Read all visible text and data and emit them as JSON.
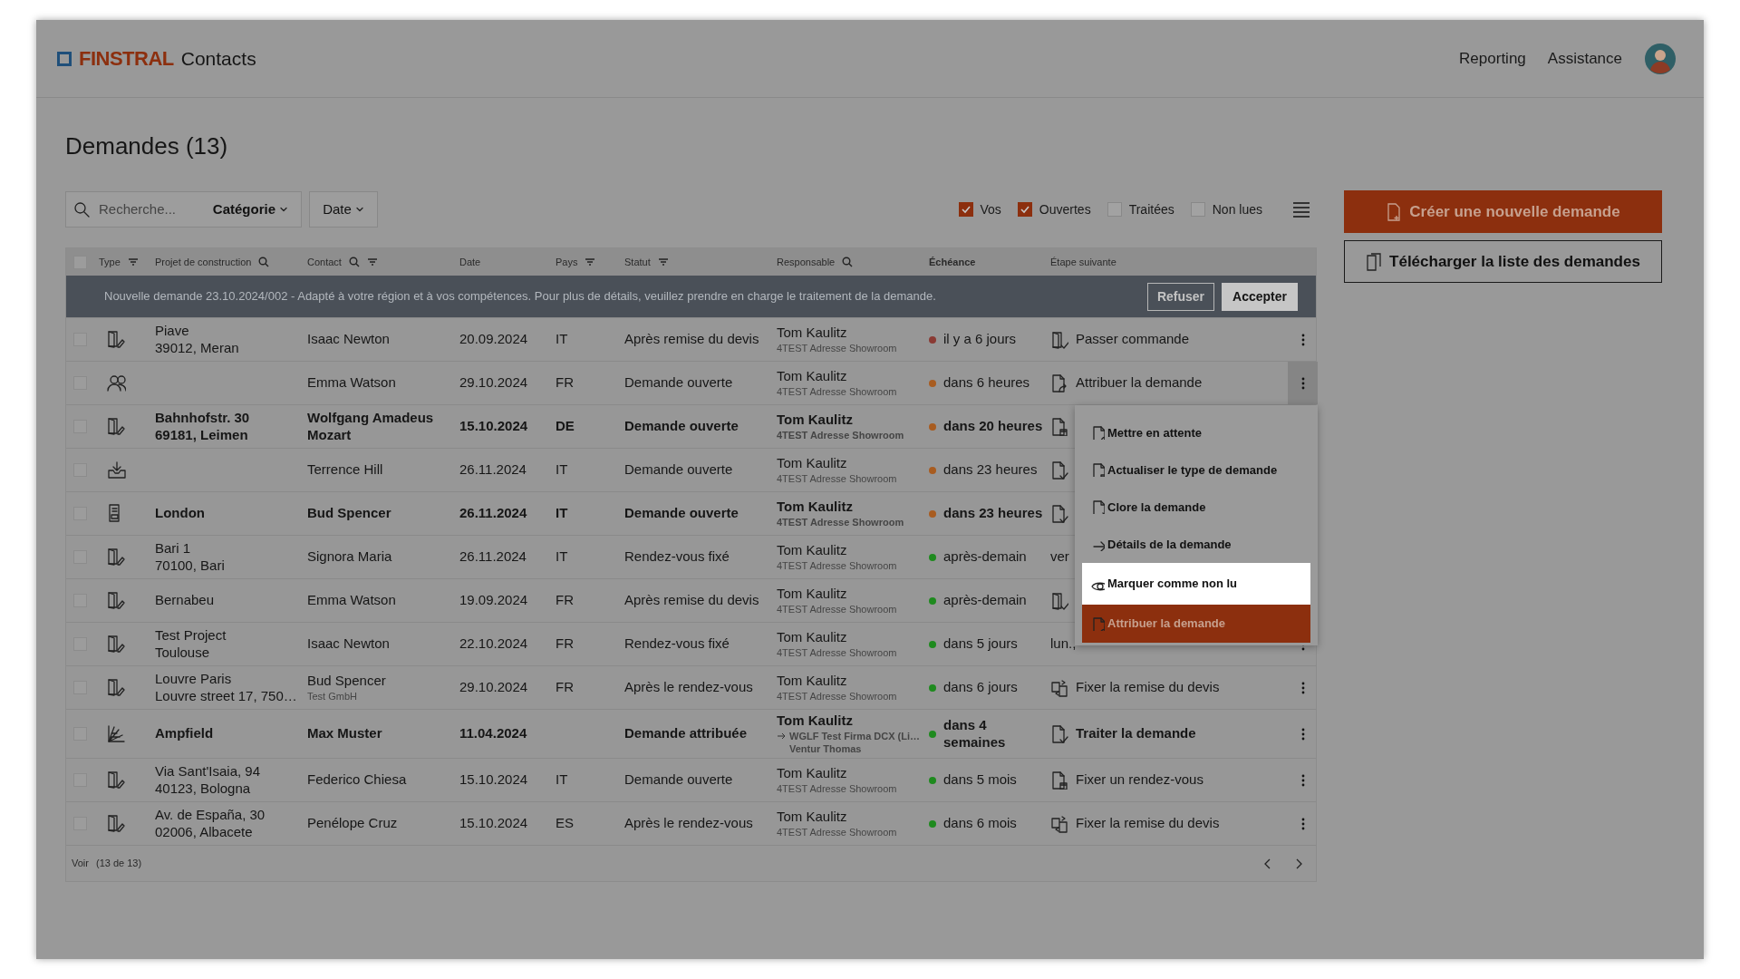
{
  "header": {
    "brand": "FINSTRAL",
    "app": "Contacts",
    "nav": [
      "Reporting",
      "Assistance"
    ]
  },
  "title": "Demandes (13)",
  "toolbar": {
    "search": {
      "placeholder": "Recherche..."
    },
    "category": "Catégorie",
    "date": "Date",
    "filters": [
      {
        "label": "Vos",
        "checked": true
      },
      {
        "label": "Ouvertes",
        "checked": true
      },
      {
        "label": "Traitées",
        "checked": false
      },
      {
        "label": "Non lues",
        "checked": false
      }
    ]
  },
  "actions": [
    {
      "kind": "primary",
      "label": "Créer une nouvelle demande"
    },
    {
      "kind": "outline",
      "label": "Télécharger la liste des demandes"
    }
  ],
  "table": {
    "select_all": {
      "checked": false
    },
    "columns": [
      {
        "label": "Type",
        "searchable": false,
        "filterable": true,
        "bold": false
      },
      {
        "label": "Projet de construction",
        "searchable": true,
        "filterable": false,
        "bold": false
      },
      {
        "label": "Contact",
        "searchable": true,
        "filterable": true,
        "bold": false
      },
      {
        "label": "Date",
        "searchable": false,
        "filterable": false,
        "bold": false
      },
      {
        "label": "Pays",
        "searchable": false,
        "filterable": true,
        "bold": false
      },
      {
        "label": "Statut",
        "searchable": false,
        "filterable": true,
        "bold": false
      },
      {
        "label": "Responsable",
        "searchable": true,
        "filterable": false,
        "bold": false
      },
      {
        "label": "Échéance",
        "searchable": false,
        "filterable": false,
        "bold": true
      },
      {
        "label": "Étape suivante",
        "searchable": false,
        "filterable": false,
        "bold": false
      }
    ],
    "banner": {
      "text": "Nouvelle demande 23.10.2024/002 - Adapté à votre région et à vos compétences. Pour plus de détails, veuillez prendre en charge le traitement de la demande.",
      "buttons": [
        {
          "kind": "outline",
          "label": "Refuser"
        },
        {
          "kind": "light",
          "label": "Accepter"
        }
      ]
    },
    "rows": [
      {
        "checked": false,
        "unread": false,
        "kind": "door",
        "project": [
          "Piave",
          "39012, Meran"
        ],
        "contact": "Isaac Newton",
        "date": "20.09.2024",
        "country": "IT",
        "status": "Après remise du devis",
        "responsible": "Tom Kaulitz",
        "responsible_sub": [
          "4TEST Adresse Showroom"
        ],
        "forwarded": false,
        "due": "il y a 6 jours",
        "color": "#8a3a34",
        "next_step": {
          "kind": "door-check",
          "text": "Passer commande"
        },
        "kebab": true,
        "menu_open": false
      },
      {
        "checked": false,
        "unread": false,
        "kind": "people",
        "project": [],
        "contact": "Emma Watson",
        "date": "29.10.2024",
        "country": "FR",
        "status": "Demande ouverte",
        "responsible": "Tom Kaulitz",
        "responsible_sub": [
          "4TEST Adresse Showroom"
        ],
        "forwarded": false,
        "due": "dans 6 heures",
        "color": "#a85c20",
        "next_step": {
          "kind": "doc-share",
          "text": "Attribuer la demande"
        },
        "kebab": true,
        "menu_open": true
      },
      {
        "checked": false,
        "unread": true,
        "kind": "door",
        "project": [
          "Bahnhofstr. 30",
          "69181, Leimen"
        ],
        "contact": "Wolfgang Amadeus Mozart",
        "date": "15.10.2024",
        "country": "DE",
        "status": "Demande ouverte",
        "responsible": "Tom Kaulitz",
        "responsible_sub": [
          "4TEST Adresse Showroom"
        ],
        "forwarded": false,
        "due": "dans 20 heures",
        "color": "#a85c20",
        "next_step": {
          "kind": "doc-box"
        }
      },
      {
        "checked": false,
        "unread": false,
        "kind": "inbox",
        "project": [],
        "contact": "Terrence Hill",
        "date": "26.11.2024",
        "country": "IT",
        "status": "Demande ouverte",
        "responsible": "Tom Kaulitz",
        "responsible_sub": [
          "4TEST Adresse Showroom"
        ],
        "forwarded": false,
        "due": "dans 23 heures",
        "color": "#a85c20",
        "next_step": {
          "kind": "doc-check"
        }
      },
      {
        "checked": false,
        "unread": true,
        "kind": "drawing",
        "project": [
          "London"
        ],
        "contact": "Bud Spencer",
        "date": "26.11.2024",
        "country": "IT",
        "status": "Demande ouverte",
        "responsible": "Tom Kaulitz",
        "responsible_sub": [
          "4TEST Adresse Showroom"
        ],
        "forwarded": false,
        "due": "dans 23 heures",
        "color": "#a85c20",
        "next_step": {
          "kind": "doc-check"
        }
      },
      {
        "checked": false,
        "unread": false,
        "kind": "door",
        "project": [
          "Bari 1",
          "70100, Bari"
        ],
        "contact": "Signora Maria",
        "date": "26.11.2024",
        "country": "IT",
        "status": "Rendez-vous fixé",
        "responsible": "Tom Kaulitz",
        "responsible_sub": [
          "4TEST Adresse Showroom"
        ],
        "forwarded": false,
        "due": "après-demain",
        "color": "#1e8a1e",
        "next_step": {
          "text": "ver"
        }
      },
      {
        "checked": false,
        "unread": false,
        "kind": "door",
        "project": [
          "Bernabeu"
        ],
        "contact": "Emma Watson",
        "date": "19.09.2024",
        "country": "FR",
        "status": "Après remise du devis",
        "responsible": "Tom Kaulitz",
        "responsible_sub": [
          "4TEST Adresse Showroom"
        ],
        "forwarded": false,
        "due": "après-demain",
        "color": "#1e8a1e",
        "next_step": {
          "kind": "door-check"
        }
      },
      {
        "checked": false,
        "unread": false,
        "kind": "door",
        "project": [
          "Test Project",
          "Toulouse"
        ],
        "contact": "Isaac Newton",
        "date": "22.10.2024",
        "country": "FR",
        "status": "Rendez-vous fixé",
        "responsible": "Tom Kaulitz",
        "responsible_sub": [
          "4TEST Adresse Showroom"
        ],
        "forwarded": false,
        "due": "dans 5 jours",
        "color": "#1e8a1e",
        "next_step": {
          "text": "lun.,"
        },
        "kebab": true,
        "menu_open": false
      },
      {
        "checked": false,
        "unread": false,
        "kind": "door",
        "project": [
          "Louvre Paris",
          "Louvre street 17, 750…"
        ],
        "contact": "Bud Spencer",
        "contact_sub": "Test GmbH",
        "date": "29.10.2024",
        "country": "FR",
        "status": "Après le rendez-vous",
        "responsible": "Tom Kaulitz",
        "responsible_sub": [
          "4TEST Adresse Showroom"
        ],
        "forwarded": false,
        "due": "dans 6 jours",
        "color": "#1e8a1e",
        "next_step": {
          "kind": "swap",
          "text": "Fixer la remise du devis"
        },
        "kebab": true,
        "menu_open": false
      },
      {
        "checked": false,
        "unread": true,
        "kind": "swatch",
        "project": [
          "Ampfield"
        ],
        "contact": "Max Muster",
        "date": "11.04.2024",
        "status": "Demande attribuée",
        "responsible": "Tom Kaulitz",
        "responsible_sub": [
          "WGLF Test Firma DCX (Li…",
          "Ventur Thomas"
        ],
        "forwarded": true,
        "due": "dans 4 semaines",
        "color": "#1e8a1e",
        "next_step": {
          "kind": "doc-check",
          "text": "Traiter la demande"
        },
        "kebab": true,
        "menu_open": false
      },
      {
        "checked": false,
        "unread": false,
        "kind": "door",
        "project": [
          "Via Sant'Isaia, 94",
          "40123, Bologna"
        ],
        "contact": "Federico Chiesa",
        "date": "15.10.2024",
        "country": "IT",
        "status": "Demande ouverte",
        "responsible": "Tom Kaulitz",
        "responsible_sub": [
          "4TEST Adresse Showroom"
        ],
        "forwarded": false,
        "due": "dans 5 mois",
        "color": "#1e8a1e",
        "next_step": {
          "kind": "doc-box",
          "text": "Fixer un rendez-vous"
        },
        "kebab": true,
        "menu_open": false
      },
      {
        "checked": false,
        "unread": false,
        "kind": "door",
        "project": [
          "Av. de España, 30",
          "02006, Albacete"
        ],
        "contact": "Penélope Cruz",
        "date": "15.10.2024",
        "country": "ES",
        "status": "Après le rendez-vous",
        "responsible": "Tom Kaulitz",
        "responsible_sub": [
          "4TEST Adresse Showroom"
        ],
        "forwarded": false,
        "due": "dans 6 mois",
        "color": "#1e8a1e",
        "next_step": {
          "kind": "swap",
          "text": "Fixer la remise du devis"
        },
        "kebab": true,
        "menu_open": false
      }
    ],
    "footer": {
      "label": "Voir",
      "count": "(13 de 13)"
    }
  },
  "row_menu": {
    "items": [
      {
        "kind": "doc-clock",
        "label": "Mettre en attente",
        "spotlit": false,
        "active": false
      },
      {
        "kind": "doc-box",
        "label": "Actualiser le type de demande",
        "spotlit": false,
        "active": false
      },
      {
        "kind": "doc-x",
        "label": "Clore la demande",
        "spotlit": false,
        "active": false
      },
      {
        "kind": "arrow",
        "label": "Détails de la demande",
        "spotlit": false,
        "active": false
      },
      {
        "kind": "eye",
        "label": "Marquer comme non lu",
        "spotlit": true,
        "active": false
      },
      {
        "kind": "doc-share",
        "label": "Attribuer la demande",
        "spotlit": false,
        "active": true
      }
    ]
  }
}
